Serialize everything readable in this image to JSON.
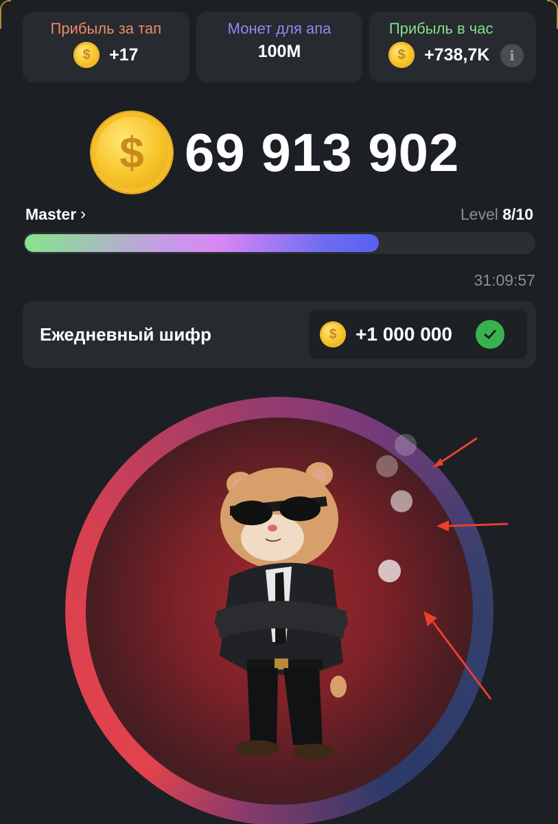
{
  "stats": [
    {
      "label": "Прибыль за тап",
      "value": "+17",
      "label_color": "#f08a67",
      "coin_icon": "coin-icon"
    },
    {
      "label": "Монет для апа",
      "value": "100M",
      "label_color": "#8a8cf4"
    },
    {
      "label": "Прибыль в час",
      "value": "+738,7K",
      "label_color": "#84e08b",
      "coin_icon": "coin-icon",
      "info_icon": "i"
    }
  ],
  "balance": {
    "value": "69 913 902"
  },
  "rank": {
    "name": "Master",
    "chevron": "›"
  },
  "level": {
    "prefix": "Level",
    "value": "8/10"
  },
  "progress": {
    "fraction": 0.695
  },
  "timer": "31:09:57",
  "cipher": {
    "label": "Ежедневный шифр",
    "reward": "+1 000 000",
    "claimed": true
  },
  "colors": {
    "background": "#1c1f24",
    "card": "#272a2f",
    "check": "#37b24d",
    "coin": "#f7c325",
    "arrow": "#e8412e"
  }
}
